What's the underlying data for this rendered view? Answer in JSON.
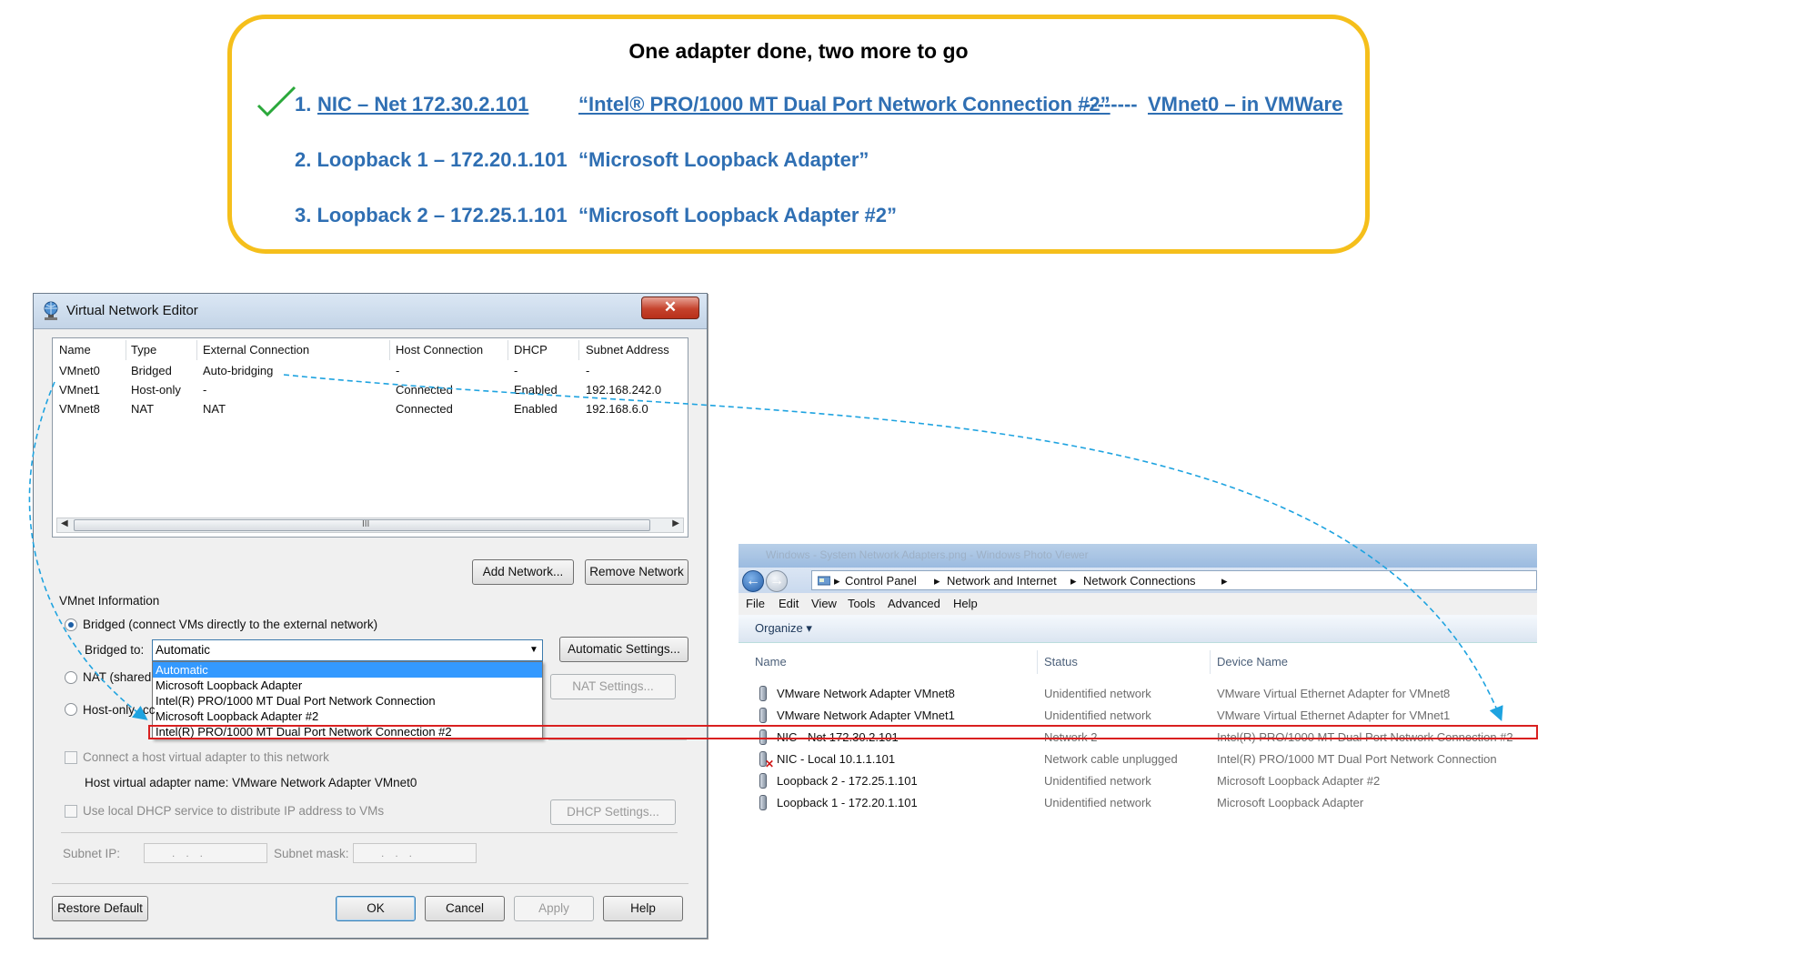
{
  "callout": {
    "title": "One adapter done, two more to go",
    "line1_num": "1.",
    "line1_name": "NIC – Net 172.30.2.101",
    "line1_device": "“Intel® PRO/1000 MT Dual Port Network Connection #2”",
    "line1_dashes": "--------",
    "line1_vmnet": "VMnet0 – in VMWare",
    "line2_name": "2. Loopback 1 – 172.20.1.101",
    "line2_device": "“Microsoft Loopback Adapter”",
    "line3_name": "3. Loopback 2 – 172.25.1.101",
    "line3_device": "“Microsoft Loopback Adapter #2”",
    "check_icon": "checkmark-icon",
    "border_color": "#f5bf1b",
    "text_color": "#2f6fb3"
  },
  "vne": {
    "title": "Virtual Network Editor",
    "close": "✕",
    "columns": [
      "Name",
      "Type",
      "External Connection",
      "Host Connection",
      "DHCP",
      "Subnet Address"
    ],
    "rows": [
      [
        "VMnet0",
        "Bridged",
        "Auto-bridging",
        "-",
        "-",
        "-"
      ],
      [
        "VMnet1",
        "Host-only",
        "-",
        "Connected",
        "Enabled",
        "192.168.242.0"
      ],
      [
        "VMnet8",
        "NAT",
        "NAT",
        "Connected",
        "Enabled",
        "192.168.6.0"
      ]
    ],
    "scroll_grip": "III",
    "add_network": "Add Network...",
    "remove_network": "Remove Network",
    "vmnet_info": "VMnet Information",
    "bridged_radio": "Bridged (connect VMs directly to the external network)",
    "bridged_to": "Bridged to:",
    "bridged_value": "Automatic",
    "automatic_settings": "Automatic Settings...",
    "dropdown_options": [
      "Automatic",
      "Microsoft Loopback Adapter",
      "Intel(R) PRO/1000 MT Dual Port Network Connection",
      "Microsoft Loopback Adapter #2",
      "Intel(R) PRO/1000 MT Dual Port Network Connection #2"
    ],
    "nat_radio": "NAT (shared",
    "nat_settings": "NAT Settings...",
    "hostonly_radio": "Host-only",
    "hostonly_suffix": "cc",
    "connect_host": "Connect a host virtual adapter to this network",
    "host_adapter_name": "Host virtual adapter name: VMware Network Adapter VMnet0",
    "use_dhcp": "Use local DHCP service to distribute IP address to VMs",
    "dhcp_settings": "DHCP Settings...",
    "subnet_ip": "Subnet IP:",
    "subnet_mask": "Subnet mask:",
    "ip_dots": "...",
    "restore_default": "Restore Default",
    "ok": "OK",
    "cancel": "Cancel",
    "apply": "Apply",
    "help": "Help"
  },
  "netconn": {
    "title": "Windows - System Network Adapters.png - Windows Photo Viewer",
    "breadcrumb": [
      "Control Panel",
      "Network and Internet",
      "Network Connections"
    ],
    "menu": [
      "File",
      "Edit",
      "View",
      "Tools",
      "Advanced",
      "Help"
    ],
    "organize": "Organize ▾",
    "columns": [
      "Name",
      "Status",
      "Device Name"
    ],
    "rows": [
      [
        "VMware Network Adapter VMnet8",
        "Unidentified network",
        "VMware Virtual Ethernet Adapter for VMnet8"
      ],
      [
        "VMware Network Adapter VMnet1",
        "Unidentified network",
        "VMware Virtual Ethernet Adapter for VMnet1"
      ],
      [
        "NIC - Net 172.30.2.101",
        "Network  2",
        "Intel(R) PRO/1000 MT Dual Port Network Connection #2"
      ],
      [
        "NIC - Local 10.1.1.101",
        "Network cable unplugged",
        "Intel(R) PRO/1000 MT Dual Port Network Connection"
      ],
      [
        "Loopback 2 - 172.25.1.101",
        "Unidentified network",
        "Microsoft Loopback Adapter #2"
      ],
      [
        "Loopback 1 - 172.20.1.101",
        "Unidentified network",
        "Microsoft Loopback Adapter"
      ]
    ],
    "highlight_color": "#d92020",
    "arrow_color": "#1ea3e0"
  }
}
